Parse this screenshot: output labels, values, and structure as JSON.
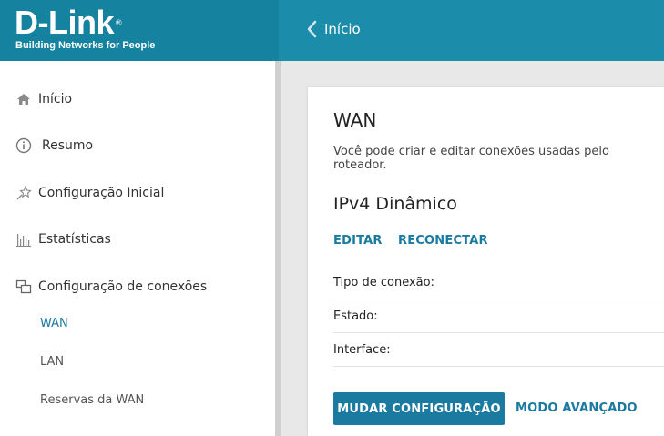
{
  "brand": {
    "logo_text": "D-Link",
    "reg_mark": "®",
    "tagline": "Building Networks for People",
    "header_color": "#1b8ca9",
    "accent_color": "#1a7aa0"
  },
  "header": {
    "back_label": "Início",
    "back_icon": "chevron-left-icon"
  },
  "sidebar": {
    "items": [
      {
        "label": "Início",
        "icon": "home-icon"
      },
      {
        "label": "Resumo",
        "icon": "info-icon"
      },
      {
        "label": "Configuração Inicial",
        "icon": "wizard-star-icon"
      },
      {
        "label": "Estatísticas",
        "icon": "bar-chart-icon"
      },
      {
        "label": "Configuração de conexões",
        "icon": "connections-icon"
      }
    ],
    "sub_items": [
      {
        "label": "WAN",
        "active": true
      },
      {
        "label": "LAN",
        "active": false
      },
      {
        "label": "Reservas da WAN",
        "active": false
      }
    ]
  },
  "main": {
    "title": "WAN",
    "description": "Você pode criar e editar conexões usadas pelo roteador.",
    "connection": {
      "name": "IPv4 Dinâmico",
      "edit_label": "EDITAR",
      "reconnect_label": "RECONECTAR",
      "fields": [
        {
          "label": "Tipo de conexão:",
          "value": ""
        },
        {
          "label": "Estado:",
          "value": ""
        },
        {
          "label": "Interface:",
          "value": ""
        }
      ]
    },
    "change_config_label": "MUDAR CONFIGURAÇÃO",
    "advanced_mode_label": "MODO AVANÇADO"
  }
}
